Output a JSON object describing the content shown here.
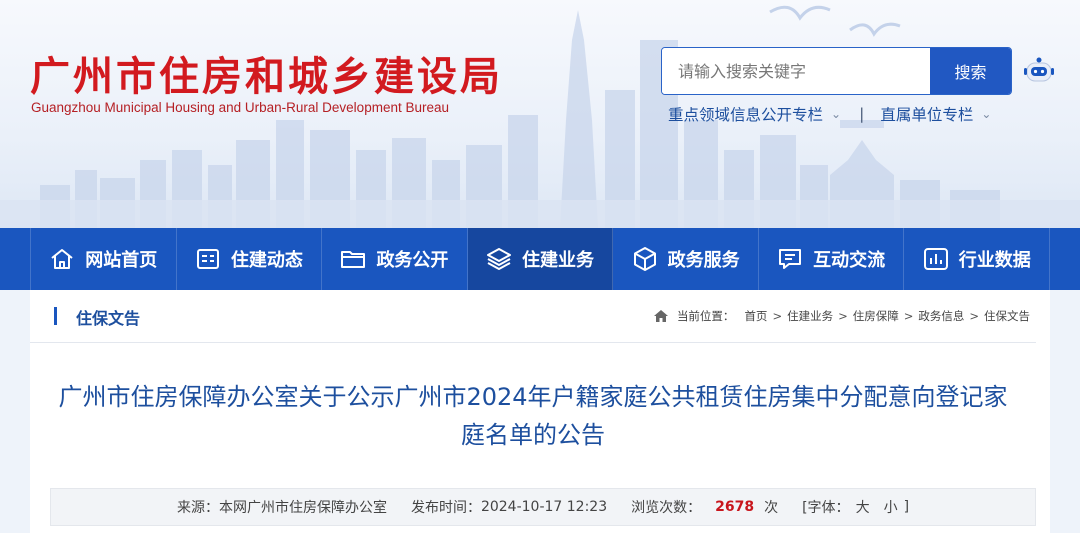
{
  "header": {
    "title_cn": "广州市住房和城乡建设局",
    "title_en": "Guangzhou Municipal Housing and Urban-Rural Development Bureau",
    "search": {
      "placeholder": "请输入搜索关键字",
      "button": "搜索"
    },
    "links": [
      {
        "label": "重点领域信息公开专栏"
      },
      {
        "label": "直属单位专栏"
      }
    ],
    "separator": "|"
  },
  "nav": {
    "items": [
      {
        "label": "网站首页",
        "icon": "home-icon"
      },
      {
        "label": "住建动态",
        "icon": "news-icon"
      },
      {
        "label": "政务公开",
        "icon": "folder-icon"
      },
      {
        "label": "住建业务",
        "icon": "layers-icon",
        "active": true
      },
      {
        "label": "政务服务",
        "icon": "cube-icon"
      },
      {
        "label": "互动交流",
        "icon": "chat-icon"
      },
      {
        "label": "行业数据",
        "icon": "chart-icon"
      }
    ]
  },
  "section": {
    "title": "住保文告",
    "breadcrumb": {
      "label": "当前位置：",
      "items": [
        "首页",
        "住建业务",
        "住房保障",
        "政务信息",
        "住保文告"
      ]
    }
  },
  "article": {
    "title": "广州市住房保障办公室关于公示广州市2024年户籍家庭公共租赁住房集中分配意向登记家庭名单的公告",
    "meta": {
      "source_label": "来源：",
      "source": "本网广州市住房保障办公室",
      "time_label": "发布时间：",
      "time": "2024-10-17 12:23",
      "views_label": "浏览次数：",
      "views": "2678",
      "views_unit": "次",
      "font_label": "[字体：",
      "font_large": "大",
      "font_small": "小",
      "font_end": "]"
    }
  },
  "colors": {
    "brand_red": "#d21a1f",
    "nav_blue": "#1a56bf",
    "title_blue": "#1d4f9e",
    "views_red": "#c8161d"
  }
}
